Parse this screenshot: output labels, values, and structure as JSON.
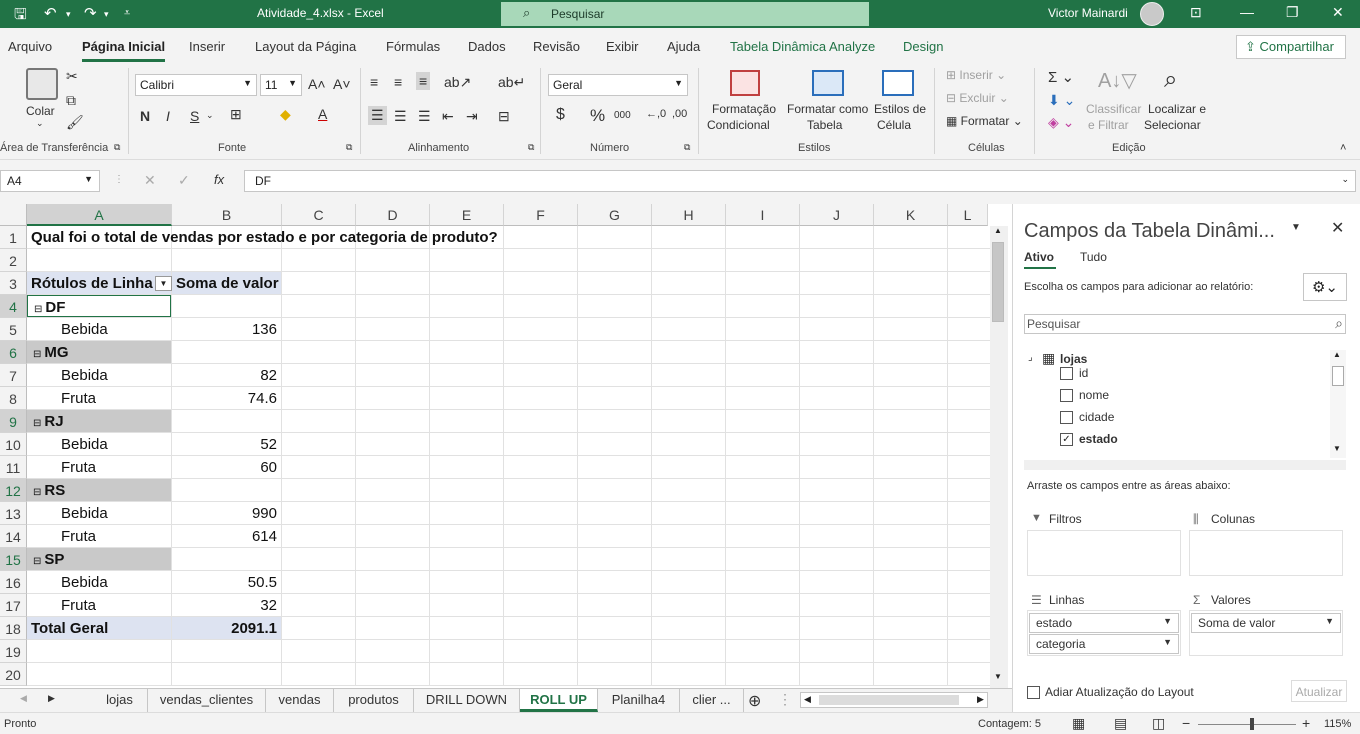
{
  "titlebar": {
    "file_title": "Atividade_4.xlsx  -  Excel",
    "search_placeholder": "Pesquisar",
    "user": "Victor Mainardi"
  },
  "menu": {
    "items": [
      "Arquivo",
      "Página Inicial",
      "Inserir",
      "Layout da Página",
      "Fórmulas",
      "Dados",
      "Revisão",
      "Exibir",
      "Ajuda",
      "Tabela Dinâmica Analyze",
      "Design"
    ],
    "share": "Compartilhar"
  },
  "ribbon": {
    "clipboard": {
      "paste": "Colar",
      "label": "Área de Transferência"
    },
    "font": {
      "family": "Calibri",
      "size": "11",
      "bold": "N",
      "italic": "I",
      "underline": "S",
      "label": "Fonte"
    },
    "alignment": {
      "label": "Alinhamento"
    },
    "number": {
      "format": "Geral",
      "label": "Número"
    },
    "styles": {
      "cond_format_1": "Formatação",
      "cond_format_2": "Condicional",
      "format_table_1": "Formatar como",
      "format_table_2": "Tabela",
      "cell_styles_1": "Estilos de",
      "cell_styles_2": "Célula",
      "label": "Estilos"
    },
    "cells": {
      "insert": "Inserir",
      "delete": "Excluir",
      "format": "Formatar",
      "label": "Células"
    },
    "editing": {
      "sort_1": "Classificar",
      "sort_2": "e Filtrar",
      "find_1": "Localizar e",
      "find_2": "Selecionar",
      "label": "Edição"
    }
  },
  "formula_bar": {
    "name_box": "A4",
    "content": "DF"
  },
  "grid": {
    "columns": [
      "A",
      "B",
      "C",
      "D",
      "E",
      "F",
      "G",
      "H",
      "I",
      "J",
      "K",
      "L"
    ],
    "rows": [
      "1",
      "2",
      "3",
      "4",
      "5",
      "6",
      "7",
      "8",
      "9",
      "10",
      "11",
      "12",
      "13",
      "14",
      "15",
      "16",
      "17",
      "18",
      "19",
      "20"
    ],
    "title": "Qual foi o total de vendas por estado e por categoria de produto?",
    "header_rows": "Rótulos de Linha",
    "header_values": "Soma de valor",
    "cells": [
      {
        "a": "DF",
        "b": "",
        "kind": "group"
      },
      {
        "a": "Bebida",
        "b": "136",
        "kind": "item"
      },
      {
        "a": "MG",
        "b": "",
        "kind": "group"
      },
      {
        "a": "Bebida",
        "b": "82",
        "kind": "item"
      },
      {
        "a": "Fruta",
        "b": "74.6",
        "kind": "item"
      },
      {
        "a": "RJ",
        "b": "",
        "kind": "group"
      },
      {
        "a": "Bebida",
        "b": "52",
        "kind": "item"
      },
      {
        "a": "Fruta",
        "b": "60",
        "kind": "item"
      },
      {
        "a": "RS",
        "b": "",
        "kind": "group"
      },
      {
        "a": "Bebida",
        "b": "990",
        "kind": "item"
      },
      {
        "a": "Fruta",
        "b": "614",
        "kind": "item"
      },
      {
        "a": "SP",
        "b": "",
        "kind": "group"
      },
      {
        "a": "Bebida",
        "b": "50.5",
        "kind": "item"
      },
      {
        "a": "Fruta",
        "b": "32",
        "kind": "item"
      }
    ],
    "total_label": "Total Geral",
    "total_value": "2091.1"
  },
  "sheet_tabs": [
    "lojas",
    "vendas_clientes",
    "vendas",
    "produtos",
    "DRILL DOWN",
    "ROLL UP",
    "Planilha4",
    "clier ..."
  ],
  "active_tab": "ROLL UP",
  "status": {
    "ready": "Pronto",
    "count": "Contagem: 5",
    "zoom": "115%"
  },
  "pivot_pane": {
    "title": "Campos da Tabela Dinâmi...",
    "tab_active": "Ativo",
    "tab_all": "Tudo",
    "choose_label": "Escolha os campos para adicionar ao relatório:",
    "search_placeholder": "Pesquisar",
    "table_name": "lojas",
    "fields": [
      {
        "name": "id",
        "checked": false
      },
      {
        "name": "nome",
        "checked": false
      },
      {
        "name": "cidade",
        "checked": false
      },
      {
        "name": "estado",
        "checked": true
      }
    ],
    "drag_label": "Arraste os campos entre as áreas abaixo:",
    "filters": "Filtros",
    "columns": "Colunas",
    "rows": "Linhas",
    "values": "Valores",
    "rows_items": [
      "estado",
      "categoria"
    ],
    "values_items": [
      "Soma de valor"
    ],
    "defer": "Adiar Atualização do Layout",
    "update": "Atualizar"
  }
}
